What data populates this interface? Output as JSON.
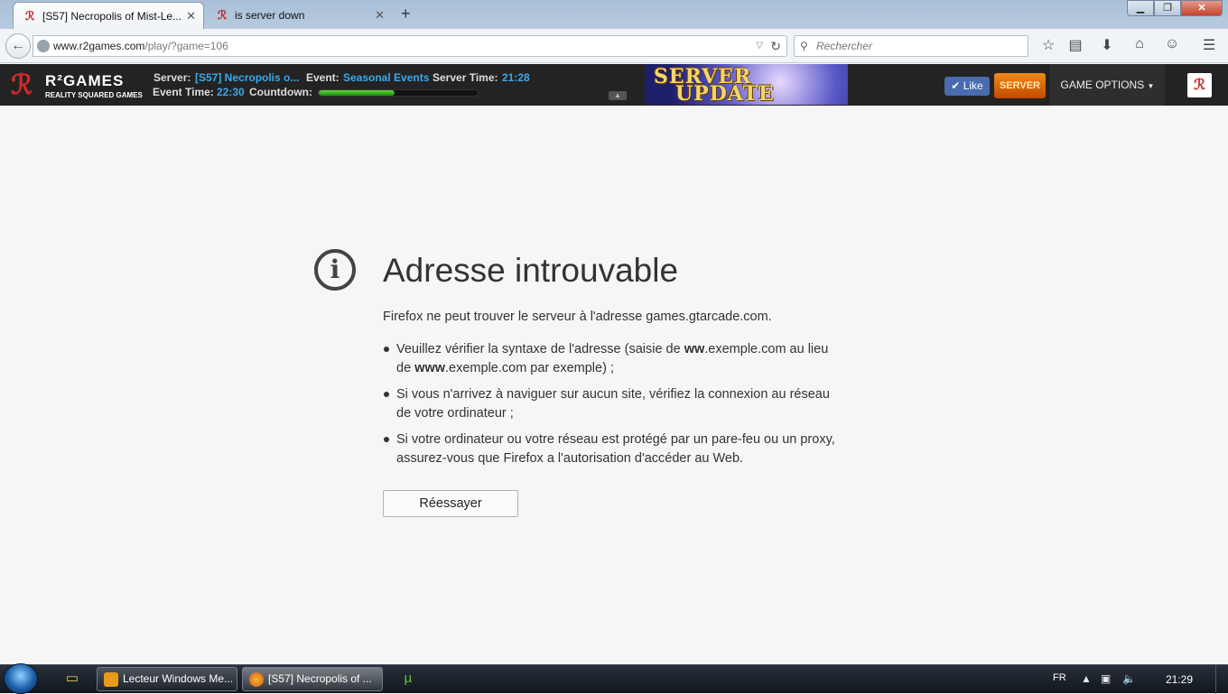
{
  "browser": {
    "tabs": [
      {
        "label": "[S57] Necropolis of Mist-Le...",
        "active": true
      },
      {
        "label": "is server down",
        "active": false
      }
    ],
    "url_domain": "www.r2games.com",
    "url_path": "/play/?game=106",
    "search_placeholder": "Rechercher",
    "toolbar_icons": [
      "bookmark-star-icon",
      "reading-list-icon",
      "download-icon",
      "home-icon",
      "chat-icon",
      "menu-icon"
    ]
  },
  "gamebar": {
    "brand": "R²GAMES",
    "tagline": "REALITY SQUARED GAMES",
    "server_label": "Server:",
    "server_value": "[S57] Necropolis o...",
    "event_label": "Event:",
    "event_value": "Seasonal Events",
    "server_time_label": "Server Time:",
    "server_time_value": "21:28",
    "event_time_label": "Event Time:",
    "event_time_value": "22:30",
    "countdown_label": "Countdown:",
    "countdown_progress": 0.48,
    "banner_line1": "SERVER",
    "banner_line2": "UPDATE",
    "like_label": "Like",
    "server_button": "SERVER",
    "game_options": "GAME OPTIONS"
  },
  "error": {
    "title": "Adresse introuvable",
    "description": "Firefox ne peut trouver le serveur à l'adresse games.gtarcade.com.",
    "items": [
      {
        "before": "Veuillez vérifier la syntaxe de l'adresse (saisie de ",
        "bold1": "ww",
        "mid": ".exemple.com au lieu de ",
        "bold2": "www",
        "after": ".exemple.com par exemple) ;"
      },
      {
        "text": "Si vous n'arrivez à naviguer sur aucun site, vérifiez la connexion au réseau de votre ordinateur ;"
      },
      {
        "text": "Si votre ordinateur ou votre réseau est protégé par un pare-feu ou un proxy, assurez-vous que Firefox a l'autorisation d'accéder au Web."
      }
    ],
    "retry_button": "Réessayer"
  },
  "taskbar": {
    "tasks": [
      {
        "label": "Lecteur Windows Me...",
        "active": false
      },
      {
        "label": "[S57] Necropolis of ...",
        "active": true
      }
    ],
    "lang": "FR",
    "clock": "21:29"
  },
  "colors": {
    "accent_blue": "#3aa9ea",
    "r2_red": "#d22a2a",
    "server_orange": "#e0780c"
  }
}
